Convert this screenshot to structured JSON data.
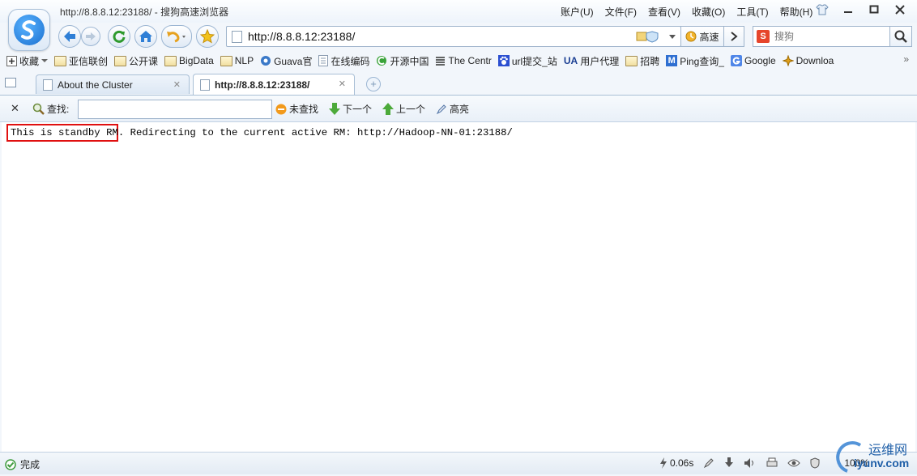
{
  "window": {
    "title": "http://8.8.8.12:23188/ - 搜狗高速浏览器",
    "menu": [
      "账户(U)",
      "文件(F)",
      "查看(V)",
      "收藏(O)",
      "工具(T)",
      "帮助(H)"
    ]
  },
  "toolbar": {
    "address": "http://8.8.8.12:23188/",
    "speed_label": "高速",
    "search_placeholder": "搜狗"
  },
  "bookmarks": {
    "collect_label": "收藏",
    "items": [
      {
        "label": "亚信联创",
        "icon": "folder-icon"
      },
      {
        "label": "公开课",
        "icon": "folder-icon"
      },
      {
        "label": "BigData",
        "icon": "folder-icon"
      },
      {
        "label": "NLP",
        "icon": "folder-icon"
      },
      {
        "label": "Guava官",
        "icon": "gear-icon"
      },
      {
        "label": "在线编码",
        "icon": "page-icon"
      },
      {
        "label": "开源中国",
        "icon": "oschina-icon"
      },
      {
        "label": "The Centr",
        "icon": "list-icon"
      },
      {
        "label": "url提交_站",
        "icon": "paw-icon"
      },
      {
        "label": "用户代理",
        "icon": "ua-icon"
      },
      {
        "label": "招聘",
        "icon": "folder-icon"
      },
      {
        "label": "Ping查询_",
        "icon": "m-icon"
      },
      {
        "label": "Google",
        "icon": "google-icon"
      },
      {
        "label": "Downloa",
        "icon": "download-icon"
      }
    ],
    "ua_badge": "UA",
    "m_badge": "M"
  },
  "tabs": [
    {
      "label": "About the Cluster",
      "active": false
    },
    {
      "label": "http://8.8.8.12:23188/",
      "active": true
    }
  ],
  "findbar": {
    "label": "查找:",
    "not_found": "未查找",
    "next": "下一个",
    "prev": "上一个",
    "highlight": "高亮"
  },
  "content": {
    "highlighted": "This is standby RM.",
    "rest": " Redirecting to the current active RM: http://Hadoop-NN-01:23188/"
  },
  "status": {
    "text": "完成",
    "time": "0.06s",
    "zoom": "100%"
  },
  "watermark": {
    "cn": "运维网",
    "en": "iyunv.com"
  },
  "colors": {
    "highlight_border": "#e01010",
    "accent": "#1a6fcf"
  }
}
